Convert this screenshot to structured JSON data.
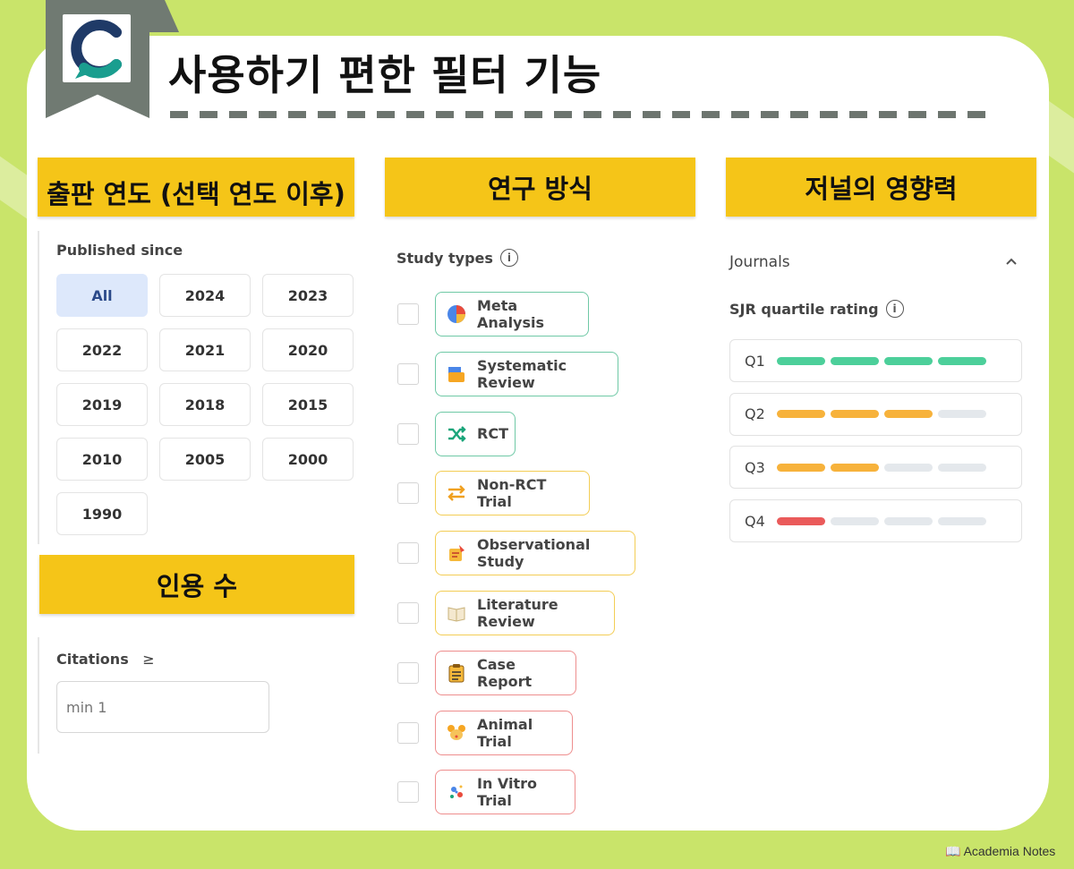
{
  "header": {
    "title": "사용하기 편한 필터 기능"
  },
  "sections": {
    "year": {
      "banner": "출판 연도 (선택 연도 이후)",
      "label": "Published since"
    },
    "study": {
      "banner": "연구 방식",
      "label": "Study types"
    },
    "journal": {
      "banner": "저널의 영향력",
      "label": "Journals",
      "sublabel": "SJR quartile rating"
    },
    "citations": {
      "banner": "인용 수",
      "label": "Citations",
      "operator": "≥",
      "placeholder": "min 1"
    }
  },
  "years": [
    "All",
    "2024",
    "2023",
    "2022",
    "2021",
    "2020",
    "2019",
    "2018",
    "2015",
    "2010",
    "2005",
    "2000",
    "1990"
  ],
  "selected_year": "All",
  "study_types": [
    {
      "label": "Meta Analysis",
      "color": "green",
      "icon": "pie-chart-icon"
    },
    {
      "label": "Systematic Review",
      "color": "green",
      "icon": "folder-icon"
    },
    {
      "label": "RCT",
      "color": "green",
      "icon": "shuffle-icon"
    },
    {
      "label": "Non-RCT Trial",
      "color": "yellow",
      "icon": "swap-arrows-icon"
    },
    {
      "label": "Observational Study",
      "color": "yellow",
      "icon": "clipboard-pencil-icon"
    },
    {
      "label": "Literature Review",
      "color": "yellow",
      "icon": "open-book-icon"
    },
    {
      "label": "Case Report",
      "color": "red",
      "icon": "clipboard-list-icon"
    },
    {
      "label": "Animal Trial",
      "color": "red",
      "icon": "mouse-icon"
    },
    {
      "label": "In Vitro Trial",
      "color": "red",
      "icon": "microbe-icon"
    }
  ],
  "quartiles": [
    {
      "label": "Q1",
      "filled": 4,
      "color": "#4ccf9a"
    },
    {
      "label": "Q2",
      "filled": 3,
      "color": "#f7b23b"
    },
    {
      "label": "Q3",
      "filled": 2,
      "color": "#f7b23b"
    },
    {
      "label": "Q4",
      "filled": 1,
      "color": "#ea5a5a"
    }
  ],
  "colors": {
    "banner": "#f5c518",
    "background": "#c9e46a",
    "logo_teal": "#1a9e8f",
    "logo_navy": "#1f3a67"
  },
  "watermark": "Academia Notes"
}
